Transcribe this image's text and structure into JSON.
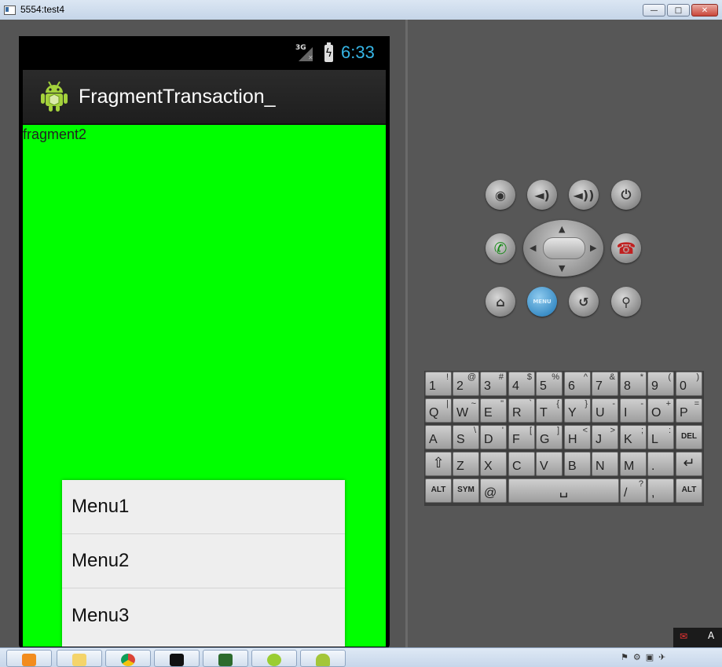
{
  "window": {
    "title": "5554:test4",
    "buttons": [
      "minimize",
      "maximize",
      "close"
    ]
  },
  "device": {
    "status_bar": {
      "network": "3G",
      "time": "6:33",
      "clock_color": "#36b5e5"
    },
    "action_bar": {
      "app_title": "FragmentTransaction_",
      "icon": "android-robot-icon"
    },
    "content": {
      "background": "#00ff00",
      "fragment_label": "fragment2"
    },
    "options_menu": {
      "items": [
        "Menu1",
        "Menu2",
        "Menu3"
      ]
    }
  },
  "hardware_controls": {
    "row1": [
      "camera-icon",
      "volume-down-icon",
      "volume-up-icon",
      "power-icon"
    ],
    "row2": [
      "call-icon",
      "dpad",
      "end-call-icon"
    ],
    "row3": [
      "home-icon",
      "MENU",
      "back-icon",
      "search-icon"
    ]
  },
  "keyboard": {
    "row1": [
      [
        "1",
        "!"
      ],
      [
        "2",
        "@"
      ],
      [
        "3",
        "#"
      ],
      [
        "4",
        "$"
      ],
      [
        "5",
        "%"
      ],
      [
        "6",
        "^"
      ],
      [
        "7",
        "&"
      ],
      [
        "8",
        "*"
      ],
      [
        "9",
        "("
      ],
      [
        "0",
        ")"
      ]
    ],
    "row2": [
      [
        "Q",
        "|"
      ],
      [
        "W",
        "~"
      ],
      [
        "E",
        "\""
      ],
      [
        "R",
        "`"
      ],
      [
        "T",
        "{"
      ],
      [
        "Y",
        "}"
      ],
      [
        "U",
        "-"
      ],
      [
        "I",
        "-"
      ],
      [
        "O",
        "+"
      ],
      [
        "P",
        "="
      ]
    ],
    "row3": [
      [
        "A",
        ""
      ],
      [
        "S",
        "\\"
      ],
      [
        "D",
        "'"
      ],
      [
        "F",
        "["
      ],
      [
        "G",
        "]"
      ],
      [
        "H",
        "<"
      ],
      [
        "J",
        ">"
      ],
      [
        "K",
        ";"
      ],
      [
        "L",
        ":"
      ],
      [
        "DEL",
        ""
      ]
    ],
    "row4": [
      [
        "⇧",
        ""
      ],
      [
        "Z",
        ""
      ],
      [
        "X",
        ""
      ],
      [
        "C",
        ""
      ],
      [
        "V",
        ""
      ],
      [
        "B",
        ""
      ],
      [
        "N",
        ""
      ],
      [
        "M",
        ""
      ],
      [
        ".",
        ""
      ],
      [
        "↵",
        ""
      ]
    ],
    "row5": [
      [
        "ALT",
        ""
      ],
      [
        "SYM",
        ""
      ],
      [
        "@",
        ""
      ],
      [
        "␣",
        ""
      ],
      [
        "/",
        "?"
      ],
      [
        ",",
        ""
      ],
      [
        "ALT",
        ""
      ]
    ]
  },
  "taskbar": {
    "apps": [
      "media-player-icon",
      "file-explorer-icon",
      "chrome-icon",
      "command-prompt-icon",
      "task-manager-icon",
      "eclipse-icon",
      "android-icon"
    ],
    "ime_label": "A"
  }
}
